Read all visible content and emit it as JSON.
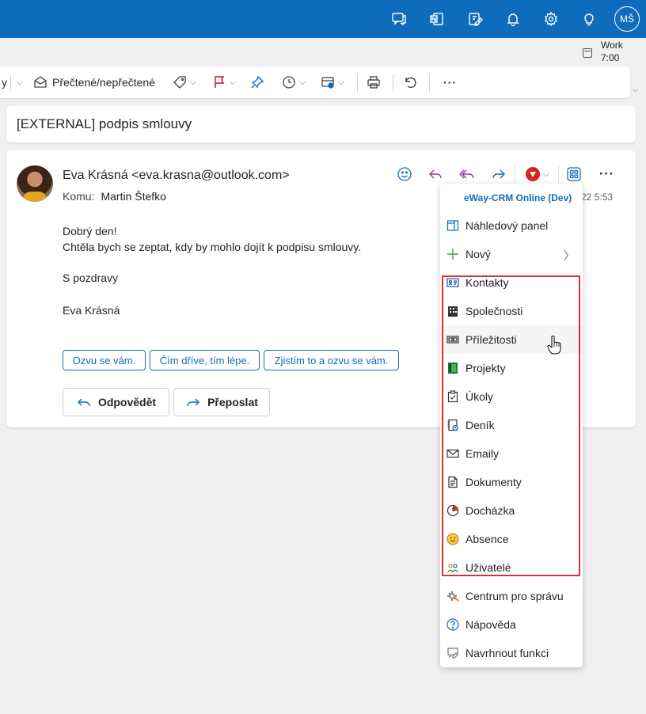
{
  "topbar": {
    "icons": [
      "chat-icon",
      "onenote-icon",
      "edit-note-icon",
      "bell-icon",
      "gear-icon",
      "lightbulb-icon"
    ],
    "user_initials": "MŠ"
  },
  "worktime": {
    "label": "Work",
    "time": "7:00"
  },
  "toolbar": {
    "read_unread_label": "Přečtené/nepřečtené"
  },
  "subject": "[EXTERNAL] podpis smlouvy",
  "message": {
    "from": "Eva Krásná <eva.krasna@outlook.com>",
    "to_label": "Komu:",
    "to_name": "Martin Štefko",
    "date_visible": "22 5:53",
    "body": {
      "greeting": "Dobrý den!",
      "line": "Chtěla bych se zeptat, kdy by mohlo dojít k podpisu smlouvy.",
      "closing": "S pozdravy",
      "signature": "Eva Krásná"
    },
    "suggested_replies": [
      "Ozvu se vám.",
      "Čím dříve, tím lépe.",
      "Zjistím to a ozvu se vám."
    ],
    "reply_label": "Odpovědět",
    "forward_label": "Přeposlat"
  },
  "menu": {
    "header": "eWay-CRM Online (Dev)",
    "items": [
      {
        "label": "Náhledový panel",
        "icon": "panel-icon"
      },
      {
        "label": "Nový",
        "icon": "plus-icon"
      },
      {
        "label": "Kontakty",
        "icon": "contact-card-icon"
      },
      {
        "label": "Společnosti",
        "icon": "building-icon"
      },
      {
        "label": "Příležitosti",
        "icon": "money-icon"
      },
      {
        "label": "Projekty",
        "icon": "project-icon"
      },
      {
        "label": "Úkoly",
        "icon": "task-icon"
      },
      {
        "label": "Deník",
        "icon": "journal-icon"
      },
      {
        "label": "Emaily",
        "icon": "mail-icon"
      },
      {
        "label": "Dokumenty",
        "icon": "document-icon"
      },
      {
        "label": "Docházka",
        "icon": "attendance-icon"
      },
      {
        "label": "Absence",
        "icon": "smiley-icon"
      },
      {
        "label": "Uživatelé",
        "icon": "users-icon"
      },
      {
        "label": "Centrum pro správu",
        "icon": "admin-icon"
      },
      {
        "label": "Nápověda",
        "icon": "help-icon"
      },
      {
        "label": "Navrhnout funkci",
        "icon": "suggest-icon"
      }
    ]
  },
  "colors": {
    "brand": "#0f6cbd",
    "highlight": "#d13438",
    "ewayRed": "#e02020"
  }
}
